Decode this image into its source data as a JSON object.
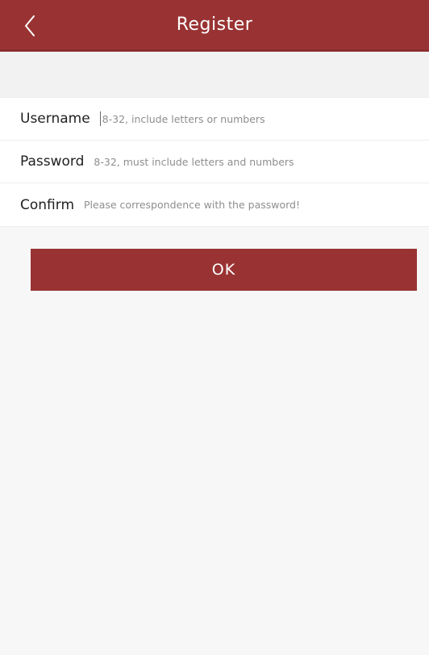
{
  "header": {
    "title": "Register",
    "back_icon": "chevron-left-icon",
    "color": "#993333"
  },
  "form": {
    "fields": [
      {
        "label": "Username",
        "value": "",
        "placeholder": "8-32, include letters or numbers"
      },
      {
        "label": "Password",
        "value": "",
        "placeholder": "8-32, must include letters and numbers"
      },
      {
        "label": "Confirm",
        "value": "",
        "placeholder": "Please correspondence with the password!"
      }
    ]
  },
  "actions": {
    "ok_label": "OK",
    "color": "#993333"
  }
}
